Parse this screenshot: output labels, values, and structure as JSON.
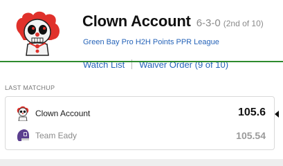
{
  "team": {
    "name": "Clown Account",
    "record": "6-3-0",
    "rank": "(2nd of 10)",
    "league": "Green Bay Pro H2H Points PPR League",
    "links": {
      "watch_list": "Watch List",
      "waiver_order": "Waiver Order (9 of 10)"
    }
  },
  "last_matchup": {
    "label": "LAST MATCHUP",
    "rows": [
      {
        "team": "Clown Account",
        "score": "105.6",
        "avatar_icon": "clown-icon",
        "winner": true
      },
      {
        "team": "Team Eady",
        "score": "105.54",
        "avatar_icon": "helmet-icon",
        "winner": false
      }
    ]
  },
  "colors": {
    "link": "#2563b8",
    "accent_green": "#2e8b2e",
    "clown_red": "#e0312b",
    "helmet_purple": "#5b3f8f"
  }
}
